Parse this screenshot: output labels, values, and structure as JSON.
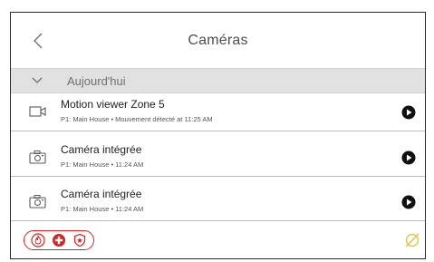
{
  "header": {
    "title": "Caméras"
  },
  "section": {
    "label": "Aujourd'hui"
  },
  "events": [
    {
      "icon": "video-camera-icon",
      "title": "Motion viewer Zone 5",
      "subtitle": "P1: Main House • Mouvement détecté at 11:25 AM"
    },
    {
      "icon": "camera-icon",
      "title": "Caméra intégrée",
      "subtitle": "P1: Main House • 11:24 AM"
    },
    {
      "icon": "camera-icon",
      "title": "Caméra intégrée",
      "subtitle": "P1: Main House • 11:24 AM"
    }
  ],
  "footer": {
    "panic_buttons": [
      "fire-icon",
      "medical-icon",
      "police-icon"
    ],
    "disarm_icon": "disarmed-status-icon"
  },
  "colors": {
    "panic": "#d02626",
    "disarm": "#d8c534",
    "section_bg": "#e1e1e1"
  },
  "corner_code": "..."
}
